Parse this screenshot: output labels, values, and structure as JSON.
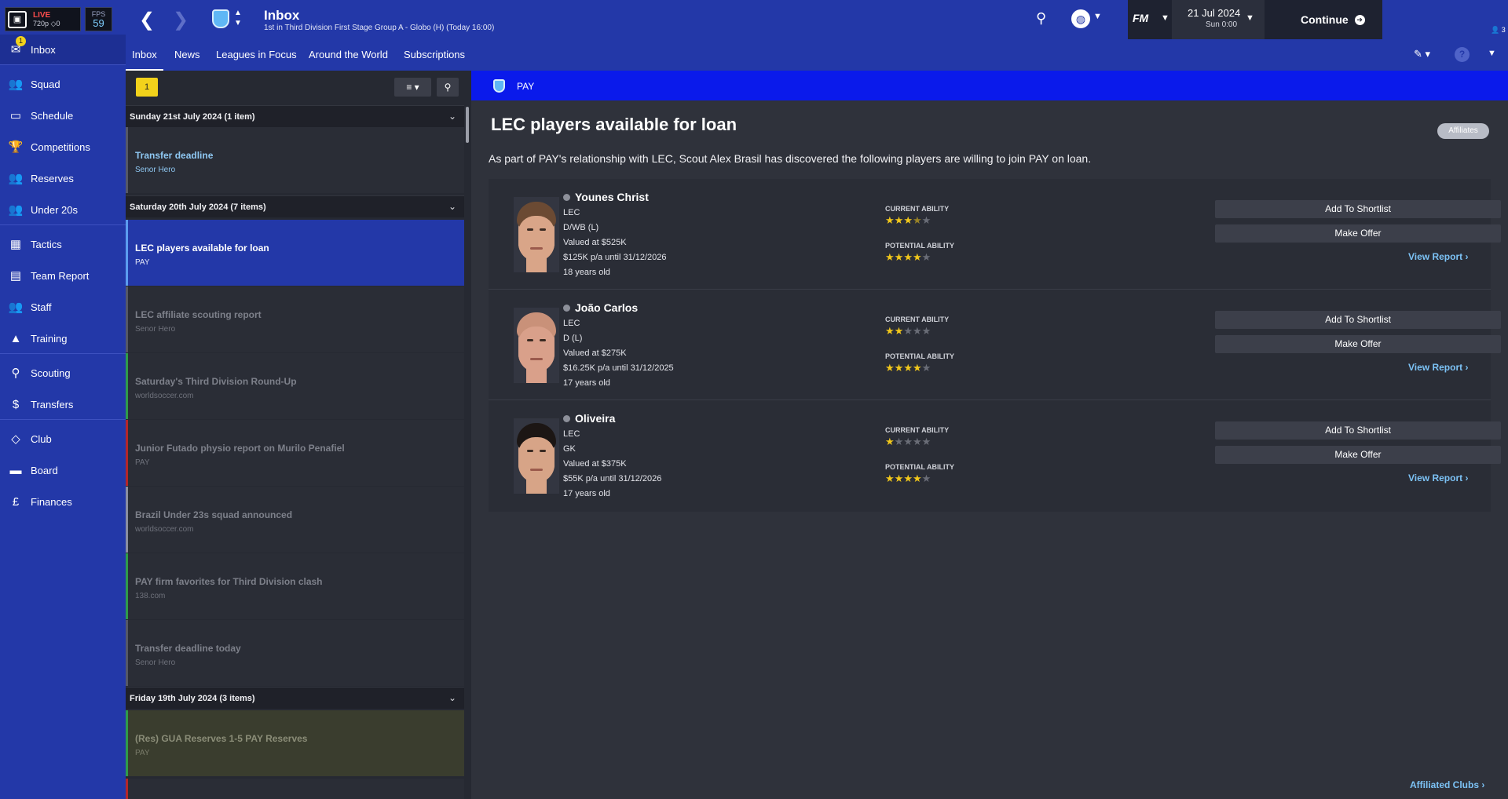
{
  "stream": {
    "twitch": "twitch",
    "live": "LIVE",
    "quality": "720p",
    "viewers": "0"
  },
  "fps": {
    "label": "FPS",
    "value": "59"
  },
  "sidebar": {
    "inbox_badge": "1",
    "items": [
      {
        "label": "Inbox",
        "icon": "inbox-icon"
      },
      {
        "label": "Squad",
        "icon": "squad-icon"
      },
      {
        "label": "Schedule",
        "icon": "schedule-icon"
      },
      {
        "label": "Competitions",
        "icon": "trophy-icon"
      },
      {
        "label": "Reserves",
        "icon": "reserves-icon"
      },
      {
        "label": "Under 20s",
        "icon": "under20s-icon"
      },
      {
        "label": "Tactics",
        "icon": "tactics-icon"
      },
      {
        "label": "Team Report",
        "icon": "team-report-icon"
      },
      {
        "label": "Staff",
        "icon": "staff-icon"
      },
      {
        "label": "Training",
        "icon": "training-icon"
      },
      {
        "label": "Scouting",
        "icon": "scouting-icon"
      },
      {
        "label": "Transfers",
        "icon": "transfers-icon"
      },
      {
        "label": "Club",
        "icon": "club-icon"
      },
      {
        "label": "Board",
        "icon": "board-icon"
      },
      {
        "label": "Finances",
        "icon": "finances-icon"
      }
    ]
  },
  "header": {
    "title": "Inbox",
    "subtitle": "1st in Third Division First Stage Group A - Globo (H) (Today 16:00)",
    "fm_label": "FM",
    "date": "21 Jul 2024",
    "time": "Sun 0:00",
    "continue_label": "Continue",
    "people_count": "3"
  },
  "subnav": {
    "tabs": [
      "Inbox",
      "News",
      "Leagues in Focus",
      "Around the World",
      "Subscriptions"
    ]
  },
  "list": {
    "unread_count": "1",
    "groups": [
      {
        "label": "Sunday 21st July 2024 (1 item)"
      },
      {
        "label": "Saturday 20th July 2024 (7 items)"
      },
      {
        "label": "Friday 19th July 2024 (3 items)"
      }
    ],
    "messages": [
      {
        "title": "Transfer deadline",
        "sender": "Senor Hero"
      },
      {
        "title": "LEC players available for loan",
        "sender": "PAY"
      },
      {
        "title": "LEC affiliate scouting report",
        "sender": "Senor Hero"
      },
      {
        "title": "Saturday's Third Division Round-Up",
        "sender": "worldsoccer.com"
      },
      {
        "title": "Junior Futado physio report on Murilo Penafiel",
        "sender": "PAY"
      },
      {
        "title": "Brazil Under 23s squad announced",
        "sender": "worldsoccer.com"
      },
      {
        "title": "PAY firm favorites for Third Division clash",
        "sender": "138.com"
      },
      {
        "title": "Transfer deadline today",
        "sender": "Senor Hero"
      },
      {
        "title": "(Res) GUA Reserves 1-5 PAY Reserves",
        "sender": "PAY"
      }
    ]
  },
  "detail": {
    "club_label": "PAY",
    "title": "LEC players available for loan",
    "tag": "Affiliates",
    "body": "As part of PAY's relationship with LEC, Scout Alex Brasil has discovered the following players are willing to join PAY on loan.",
    "current_ability_label": "CURRENT ABILITY",
    "potential_ability_label": "POTENTIAL ABILITY",
    "shortlist_label": "Add To Shortlist",
    "offer_label": "Make Offer",
    "view_report_label": "View Report ›",
    "affiliated_clubs_label": "Affiliated Clubs ›",
    "players": [
      {
        "name": "Younes Christ",
        "club": "LEC",
        "position": "D/WB (L)",
        "value": "Valued at $525K",
        "wage": "$125K p/a until 31/12/2026",
        "age": "18 years old",
        "current_ability_stars": 3.5,
        "potential_ability_stars": 4,
        "skin": "#d9a588",
        "hair": "#6b4a33"
      },
      {
        "name": "João Carlos",
        "club": "LEC",
        "position": "D (L)",
        "value": "Valued at $275K",
        "wage": "$16.25K p/a until 31/12/2025",
        "age": "17 years old",
        "current_ability_stars": 2,
        "potential_ability_stars": 4,
        "skin": "#d9a08a",
        "hair": "#c99179"
      },
      {
        "name": "Oliveira",
        "club": "LEC",
        "position": "GK",
        "value": "Valued at $375K",
        "wage": "$55K p/a until 31/12/2026",
        "age": "17 years old",
        "current_ability_stars": 1,
        "potential_ability_stars": 4,
        "skin": "#d7a487",
        "hair": "#1c1614"
      }
    ]
  }
}
